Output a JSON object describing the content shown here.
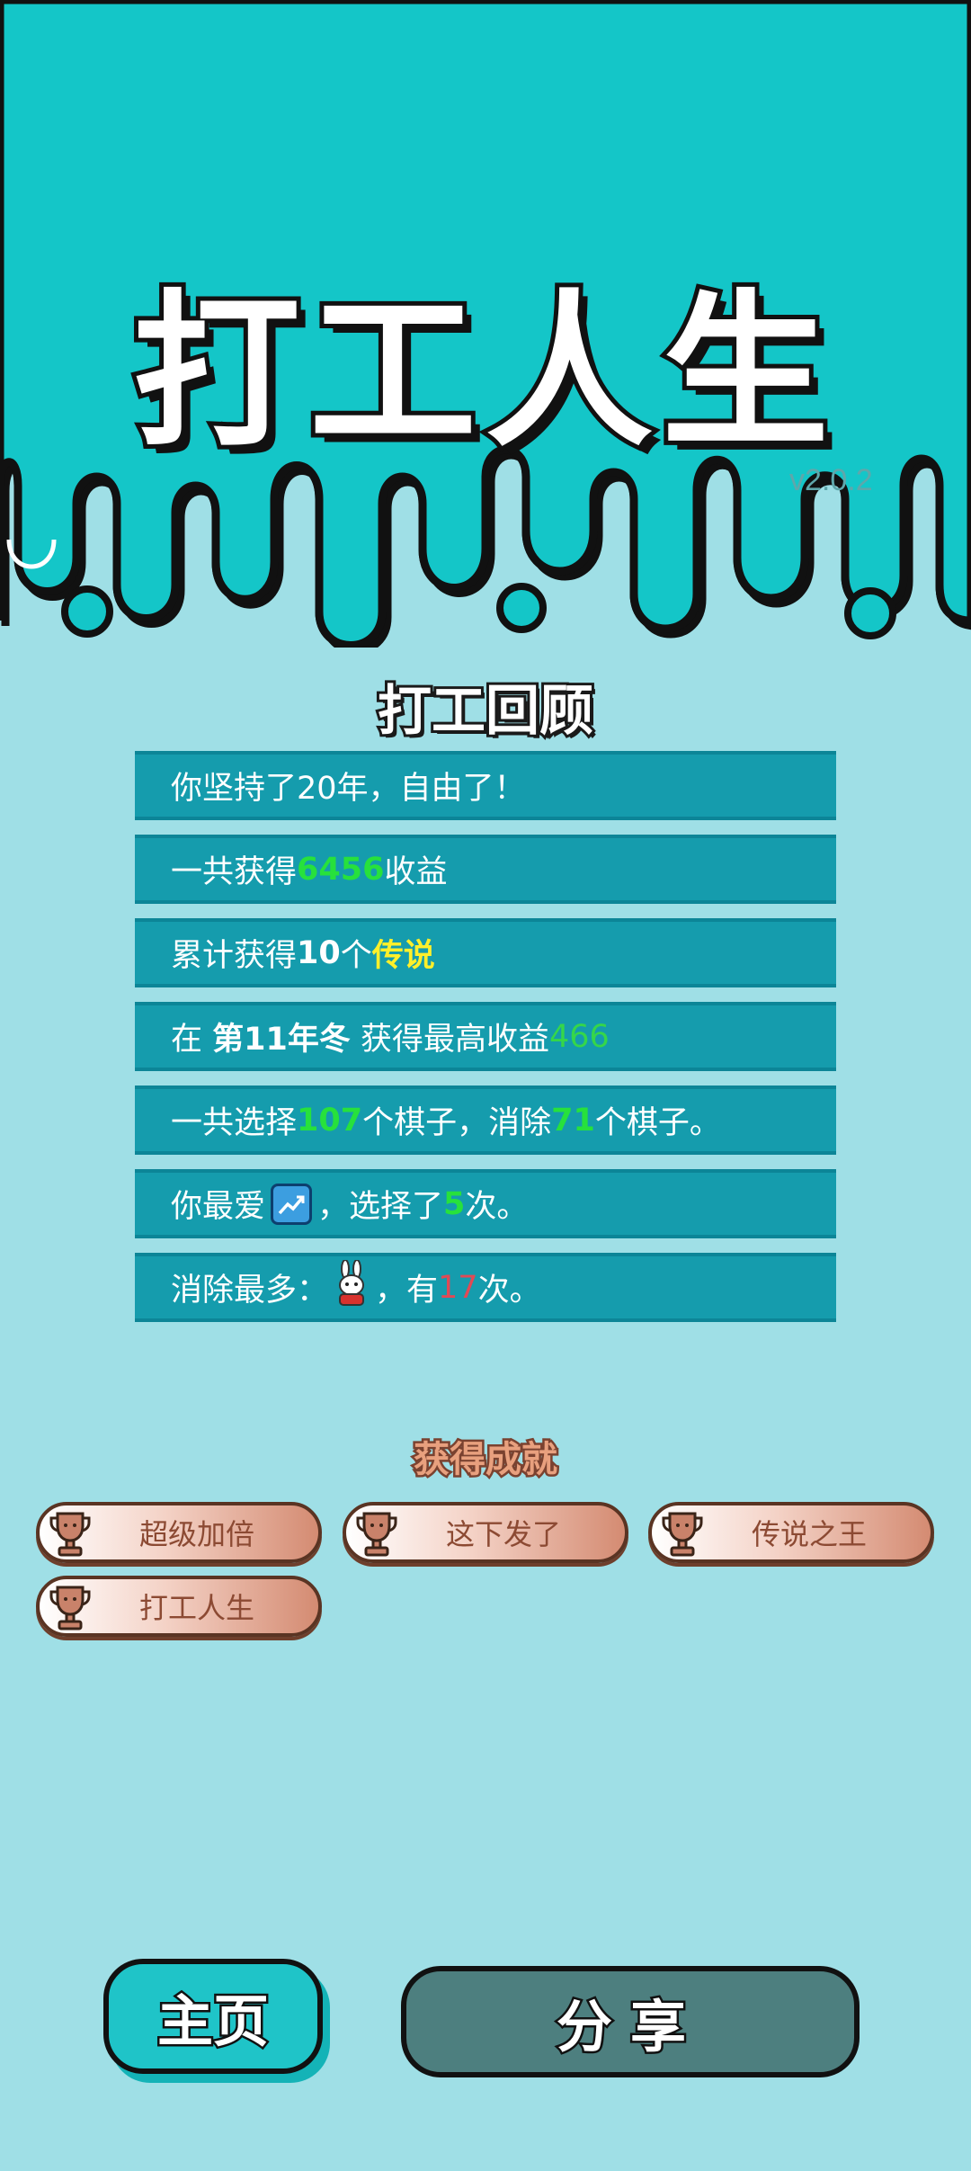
{
  "header": {
    "app_title": "打工人生",
    "version": "v2.0.2"
  },
  "review": {
    "title": "打工回顾",
    "rows": [
      {
        "text": "你坚持了20年，自由了！"
      },
      {
        "prefix": "一共获得",
        "value": "6456",
        "suffix": "收益"
      },
      {
        "prefix": "累计获得",
        "count": "10",
        "unit": "个",
        "rarity": "传说"
      },
      {
        "prefix": "在 ",
        "period": "第11年冬",
        "middle": " 获得最高收益",
        "value": "466"
      },
      {
        "prefix": "一共选择",
        "chosen": "107",
        "middle": "个棋子，消除",
        "removed": "71",
        "suffix": "个棋子。"
      },
      {
        "prefix": "你最爱",
        "icon": "chart-up-icon",
        "middle": "，选择了",
        "count": "5",
        "suffix": "次。"
      },
      {
        "prefix": "消除最多：",
        "icon": "rabbit-icon",
        "middle": "，有",
        "count": "17",
        "suffix": "次。"
      }
    ]
  },
  "achievements": {
    "title": "获得成就",
    "items": [
      {
        "label": "超级加倍",
        "icon": "trophy-icon"
      },
      {
        "label": "这下发了",
        "icon": "trophy-icon"
      },
      {
        "label": "传说之王",
        "icon": "trophy-icon"
      },
      {
        "label": "打工人生",
        "icon": "trophy-icon"
      }
    ]
  },
  "buttons": {
    "home_label": "主页",
    "share_label": "分享"
  },
  "colors": {
    "top_band": "#14c6c8",
    "background": "#9fdfe6",
    "row": "#159cad",
    "highlight_green": "#27e13c",
    "highlight_yellow": "#fff02a",
    "highlight_red": "#e04a55"
  }
}
